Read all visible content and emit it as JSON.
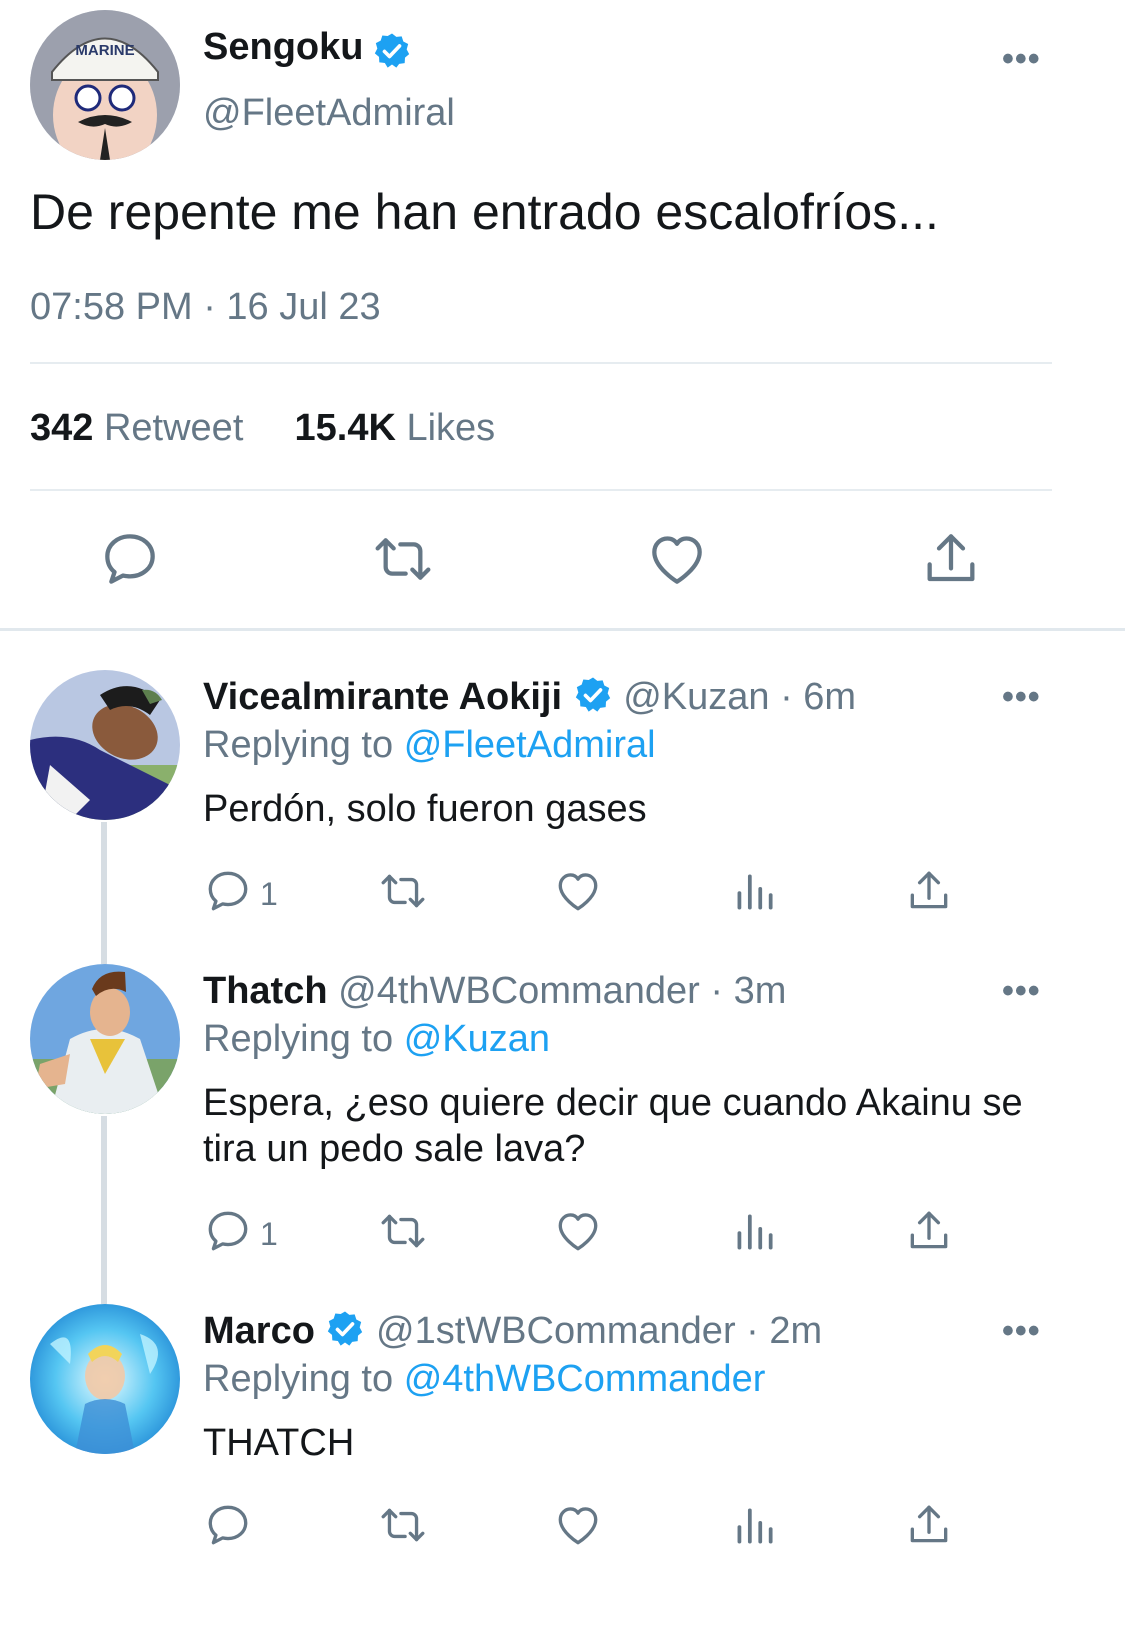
{
  "main_tweet": {
    "name": "Sengoku",
    "handle": "@FleetAdmiral",
    "text": "De repente me han entrado escalofríos...",
    "timestamp": "07:58 PM · 16 Jul 23",
    "retweets_count": "342",
    "retweets_label": "Retweet",
    "likes_count": "15.4K",
    "likes_label": "Likes",
    "more_label": "•••",
    "avatar_cap_text": "MARINE"
  },
  "replies": [
    {
      "name": "Vicealmirante Aokiji",
      "verified": true,
      "handle": "@Kuzan",
      "time": "· 6m",
      "replying_label": "Replying to",
      "replying_to": "@FleetAdmiral",
      "text": "Perdón, solo fueron gases",
      "reply_count": "1",
      "more_label": "•••"
    },
    {
      "name": "Thatch",
      "verified": false,
      "handle": "@4thWBCommander",
      "time": "· 3m",
      "replying_label": "Replying to",
      "replying_to": "@Kuzan",
      "text": "Espera, ¿eso quiere decir que cuando Akainu se tira un pedo sale lava?",
      "reply_count": "1",
      "more_label": "•••"
    },
    {
      "name": "Marco",
      "verified": true,
      "handle": "@1stWBCommander",
      "time": "· 2m",
      "replying_label": "Replying to",
      "replying_to": "@4thWBCommander",
      "text": "THATCH",
      "reply_count": "",
      "more_label": "•••"
    }
  ],
  "colors": {
    "accent": "#1da1f2",
    "secondary_text": "#657786",
    "divider": "#e6ecf0"
  },
  "icons": [
    "verified-icon",
    "more-icon",
    "reply-icon",
    "retweet-icon",
    "like-icon",
    "share-icon",
    "analytics-icon"
  ]
}
